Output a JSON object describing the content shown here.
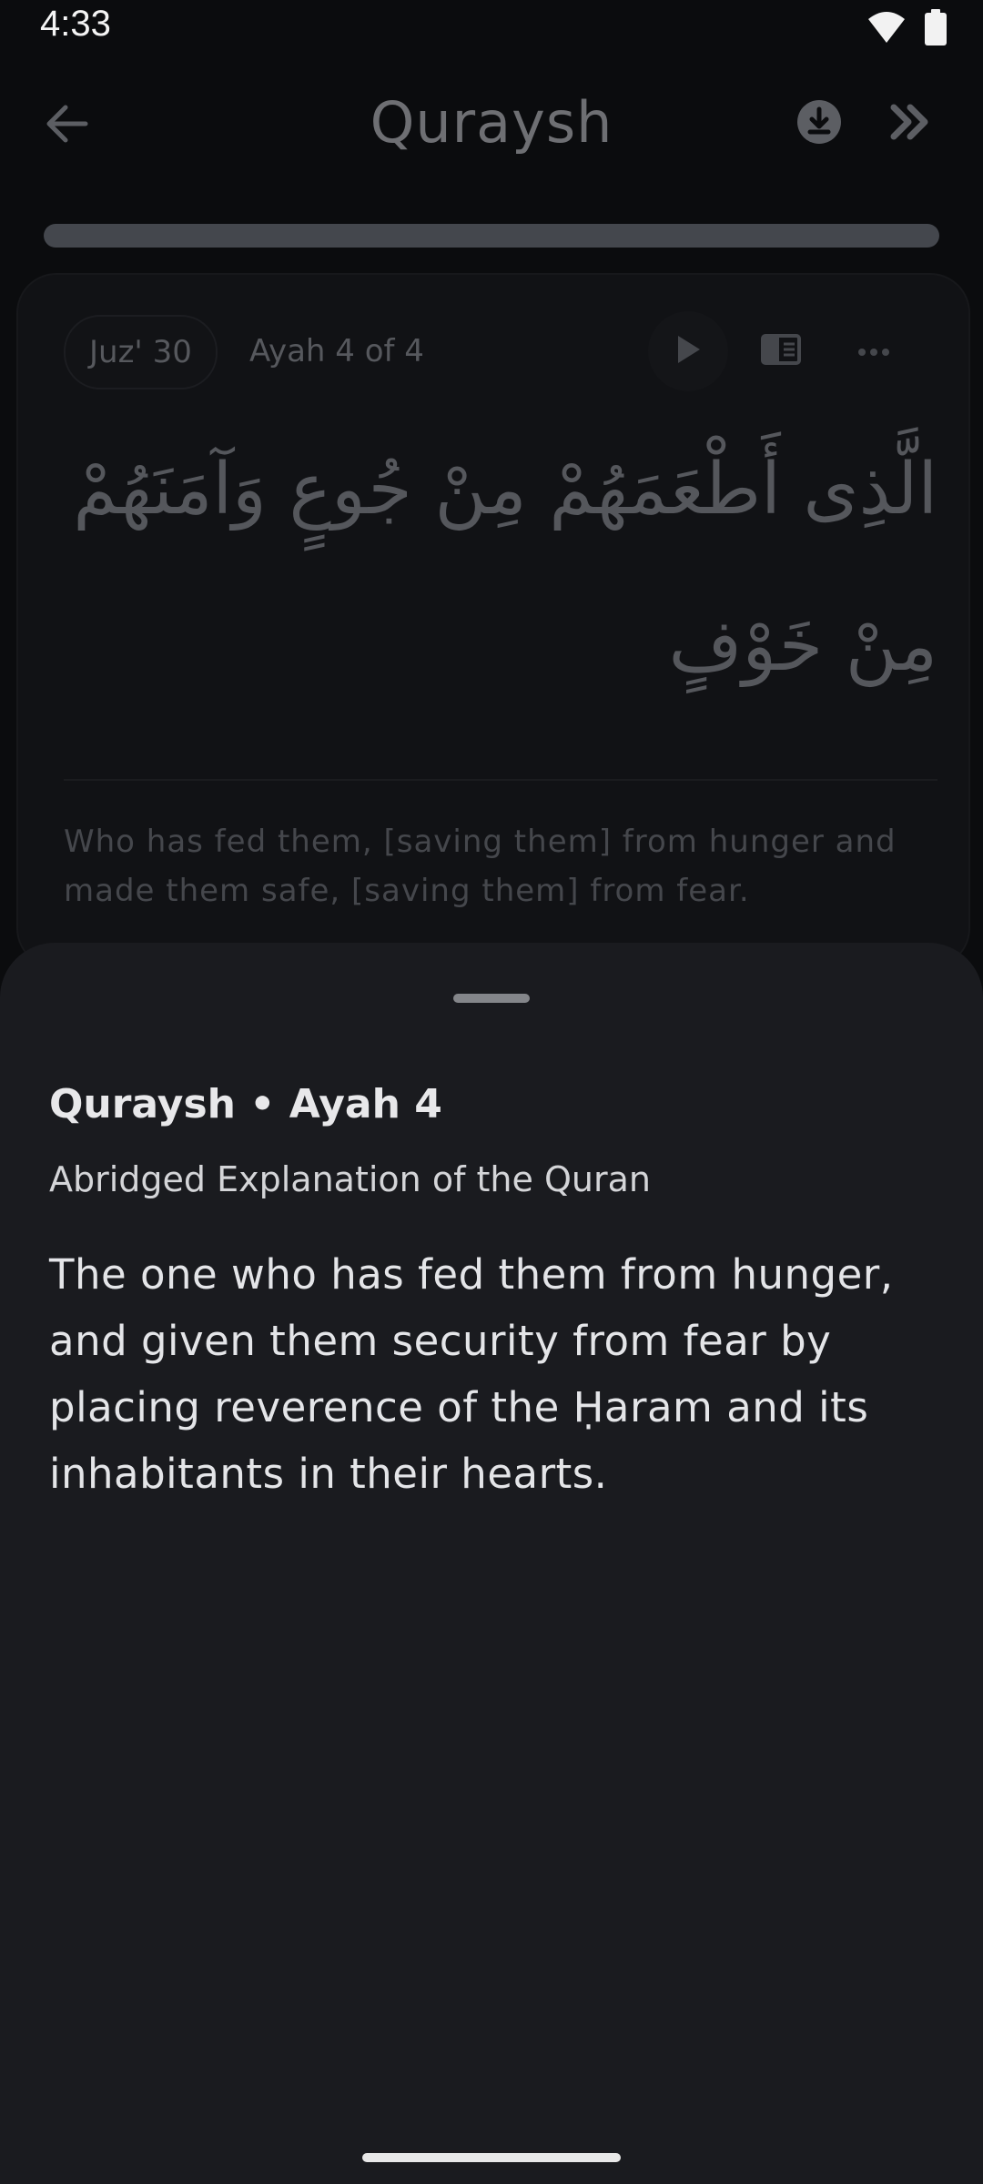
{
  "status_bar": {
    "time": "4:33",
    "icons": [
      "wifi-icon",
      "battery-icon"
    ]
  },
  "toolbar": {
    "title": "Quraysh",
    "back_icon": "arrow-left-icon",
    "download_icon": "download-circle-icon",
    "next_icon": "double-chevron-right-icon"
  },
  "progress": {
    "value": 1.0
  },
  "ayah_card": {
    "juz_badge": "Juz' 30",
    "ayah_count": "Ayah 4 of 4",
    "arabic": "الَّذِى أَطْعَمَهُمْ مِنْ جُوعٍ وَآمَنَهُمْ مِنْ خَوْفٍ",
    "translation": "Who has fed them, [saving them] from hunger and made them safe, [saving them] from fear.",
    "actions": [
      "play-icon",
      "tafsir-icon",
      "more-icon"
    ]
  },
  "sheet": {
    "heading": "Quraysh • Ayah 4",
    "subtitle": "Abridged Explanation of the Quran",
    "body": "The one who has fed them from hunger, and given them security from fear by placing reverence of the Ḥaram and its inhabitants in their hearts."
  },
  "colors": {
    "background": "#0b0c0e",
    "sheet": "#1a1b1f",
    "dim_text": "#55575c",
    "bright_text": "#e4e5e8"
  }
}
